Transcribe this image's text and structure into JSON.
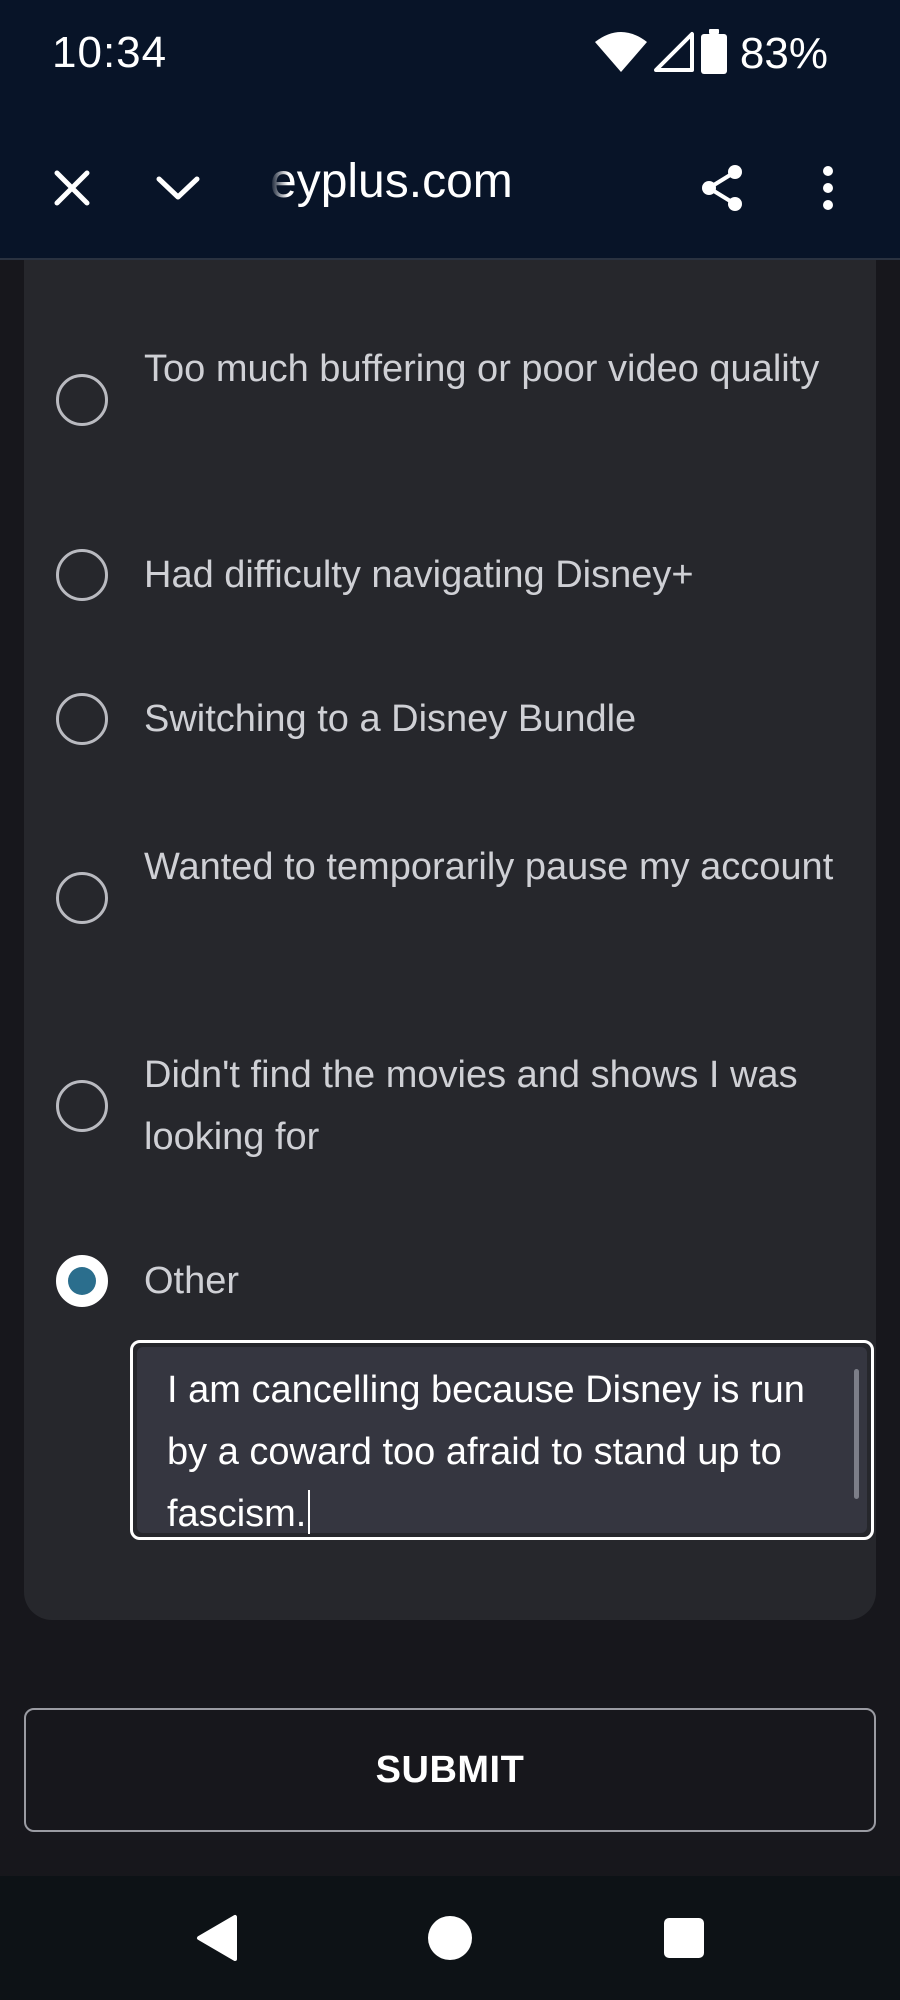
{
  "status_bar": {
    "time": "10:34",
    "battery_percent": "83%",
    "icons": [
      "wifi-icon",
      "cellular-signal-icon",
      "battery-icon"
    ]
  },
  "browser": {
    "url": "eyplus.com",
    "buttons": [
      "close-icon",
      "chevron-down-icon",
      "share-icon",
      "more-vert-icon"
    ]
  },
  "survey": {
    "options": [
      {
        "label": "Too much buffering or poor video quality",
        "selected": false
      },
      {
        "label": "Had difficulty navigating Disney+",
        "selected": false
      },
      {
        "label": "Switching to a Disney Bundle",
        "selected": false
      },
      {
        "label": "Wanted to temporarily pause my account",
        "selected": false
      },
      {
        "label": "Didn't find the movies and shows I was looking for",
        "selected": false
      },
      {
        "label": "Other",
        "selected": true
      }
    ],
    "other_text": "I am cancelling because Disney is run by a coward too afraid to stand up to fascism.",
    "submit_label": "SUBMIT"
  },
  "colors": {
    "status_bg": "#081428",
    "card_bg": "#26272c",
    "page_bg": "#17171c",
    "radio_accent": "#2b6e8d"
  },
  "nav": {
    "buttons": [
      "back-icon",
      "home-icon",
      "recents-icon"
    ]
  }
}
